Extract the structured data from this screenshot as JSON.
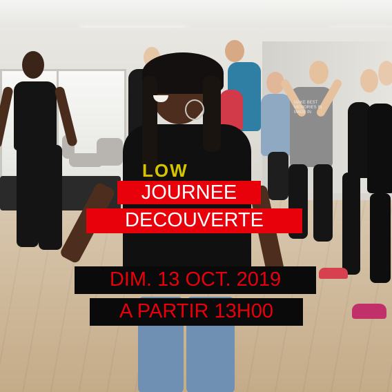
{
  "poster": {
    "line1": "JOURNEE",
    "line2": "DECOUVERTE",
    "line3": "DIM. 13 OCT. 2019",
    "line4": "A PARTIR 13H00",
    "shirt_text": "LOW",
    "tshirt_slogan": "MAKE BEST MEMORIES IN MADE IN"
  },
  "colors": {
    "highlight_red": "#e8000b",
    "box_black": "#0a0a0a",
    "text_white": "#ffffff"
  }
}
